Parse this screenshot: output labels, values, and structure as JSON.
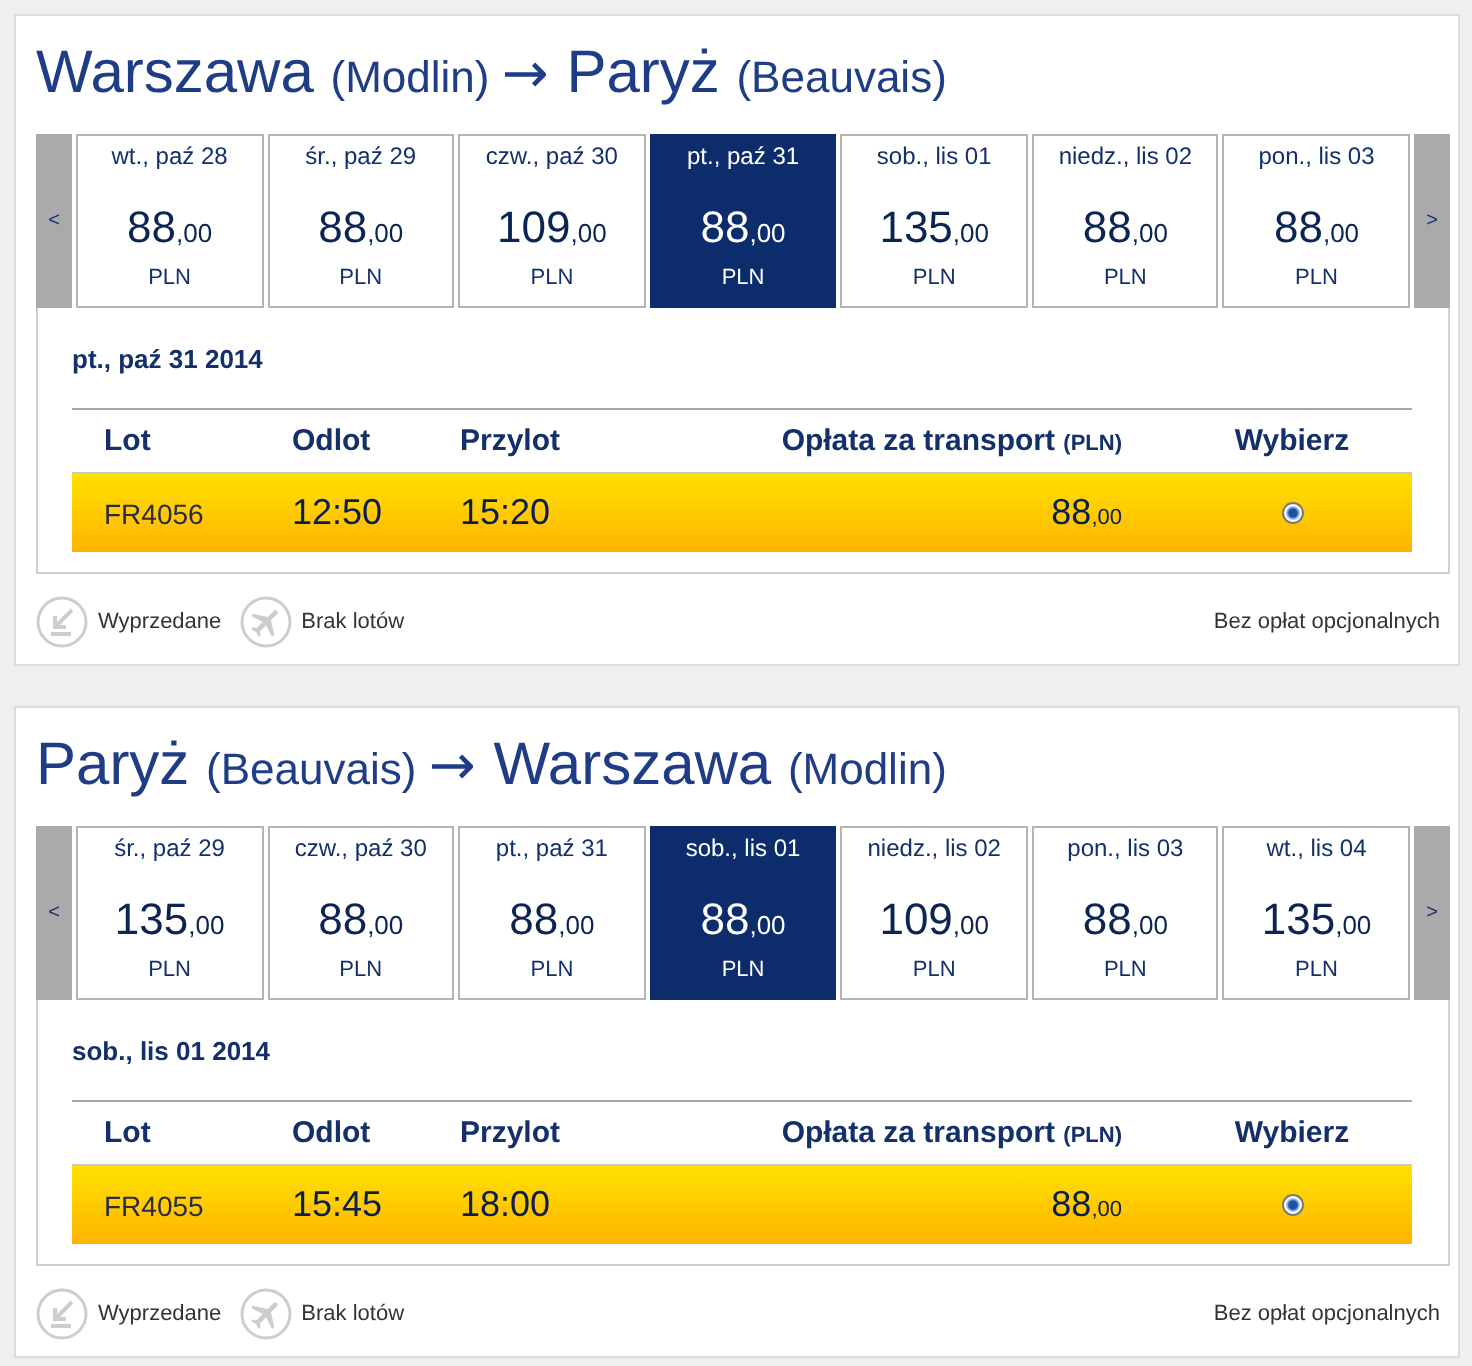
{
  "sections": [
    {
      "route": [
        {
          "kind": "city",
          "text": "Warszawa"
        },
        {
          "kind": "airport",
          "text": "(Modlin)"
        },
        {
          "kind": "arrow",
          "text": "→"
        },
        {
          "kind": "city",
          "text": "Paryż"
        },
        {
          "kind": "airport",
          "text": "(Beauvais)"
        }
      ],
      "prev_button": "<",
      "next_button": ">",
      "dates": [
        {
          "label": "wt., paź 28",
          "price": "88",
          "decimals": ",00",
          "currency": "PLN",
          "selected": false
        },
        {
          "label": "śr., paź 29",
          "price": "88",
          "decimals": ",00",
          "currency": "PLN",
          "selected": false
        },
        {
          "label": "czw., paź 30",
          "price": "109",
          "decimals": ",00",
          "currency": "PLN",
          "selected": false
        },
        {
          "label": "pt., paź 31",
          "price": "88",
          "decimals": ",00",
          "currency": "PLN",
          "selected": true
        },
        {
          "label": "sob., lis 01",
          "price": "135",
          "decimals": ",00",
          "currency": "PLN",
          "selected": false
        },
        {
          "label": "niedz., lis 02",
          "price": "88",
          "decimals": ",00",
          "currency": "PLN",
          "selected": false
        },
        {
          "label": "pon., lis 03",
          "price": "88",
          "decimals": ",00",
          "currency": "PLN",
          "selected": false
        }
      ],
      "selected_date": "pt., paź 31 2014",
      "table": {
        "columns": [
          {
            "label": "Lot"
          },
          {
            "label": "Odlot"
          },
          {
            "label": "Przylot"
          },
          {
            "label": "Opłata za transport",
            "unit": "(PLN)"
          },
          {
            "label": "Wybierz"
          }
        ],
        "rows": [
          {
            "flight": "FR4056",
            "departure": "12:50",
            "arrival": "15:20",
            "fare": "88",
            "fare_decimals": ",00",
            "selected": true
          }
        ]
      },
      "legend": [
        {
          "kind": "sold_out",
          "label": "Wyprzedane"
        },
        {
          "kind": "no_flights",
          "label": "Brak lotów"
        }
      ],
      "note": "Bez opłat opcjonalnych"
    },
    {
      "route": [
        {
          "kind": "city",
          "text": "Paryż"
        },
        {
          "kind": "airport",
          "text": "(Beauvais)"
        },
        {
          "kind": "arrow",
          "text": "→"
        },
        {
          "kind": "city",
          "text": "Warszawa"
        },
        {
          "kind": "airport",
          "text": "(Modlin)"
        }
      ],
      "prev_button": "<",
      "next_button": ">",
      "dates": [
        {
          "label": "śr., paź 29",
          "price": "135",
          "decimals": ",00",
          "currency": "PLN",
          "selected": false
        },
        {
          "label": "czw., paź 30",
          "price": "88",
          "decimals": ",00",
          "currency": "PLN",
          "selected": false
        },
        {
          "label": "pt., paź 31",
          "price": "88",
          "decimals": ",00",
          "currency": "PLN",
          "selected": false
        },
        {
          "label": "sob., lis 01",
          "price": "88",
          "decimals": ",00",
          "currency": "PLN",
          "selected": true
        },
        {
          "label": "niedz., lis 02",
          "price": "109",
          "decimals": ",00",
          "currency": "PLN",
          "selected": false
        },
        {
          "label": "pon., lis 03",
          "price": "88",
          "decimals": ",00",
          "currency": "PLN",
          "selected": false
        },
        {
          "label": "wt., lis 04",
          "price": "135",
          "decimals": ",00",
          "currency": "PLN",
          "selected": false
        }
      ],
      "selected_date": "sob., lis 01 2014",
      "table": {
        "columns": [
          {
            "label": "Lot"
          },
          {
            "label": "Odlot"
          },
          {
            "label": "Przylot"
          },
          {
            "label": "Opłata za transport",
            "unit": "(PLN)"
          },
          {
            "label": "Wybierz"
          }
        ],
        "rows": [
          {
            "flight": "FR4055",
            "departure": "15:45",
            "arrival": "18:00",
            "fare": "88",
            "fare_decimals": ",00",
            "selected": true
          }
        ]
      },
      "legend": [
        {
          "kind": "sold_out",
          "label": "Wyprzedane"
        },
        {
          "kind": "no_flights",
          "label": "Brak lotów"
        }
      ],
      "note": "Bez opłat opcjonalnych"
    }
  ]
}
